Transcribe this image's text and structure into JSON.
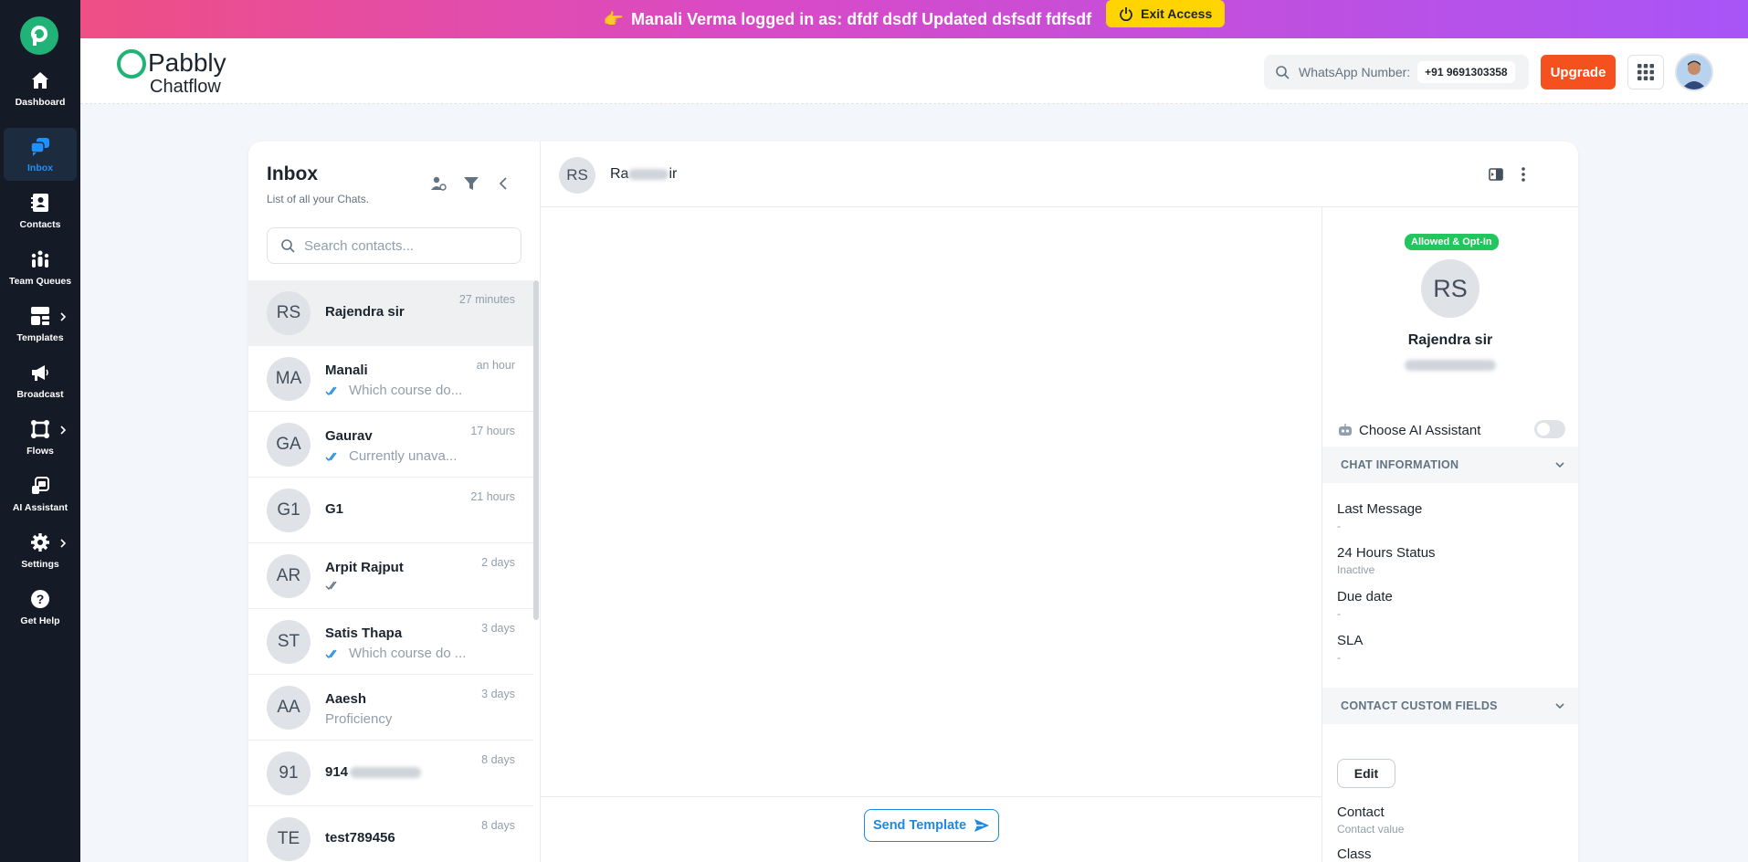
{
  "nav": {
    "items": [
      {
        "label": "Dashboard"
      },
      {
        "label": "Inbox"
      },
      {
        "label": "Contacts"
      },
      {
        "label": "Team Queues"
      },
      {
        "label": "Templates"
      },
      {
        "label": "Broadcast"
      },
      {
        "label": "Flows"
      },
      {
        "label": "AI Assistant"
      },
      {
        "label": "Settings"
      },
      {
        "label": "Get Help"
      }
    ],
    "active": "Inbox"
  },
  "banner": {
    "emoji": "👉",
    "text": "Manali Verma logged in as: dfdf dsdf Updated dsfsdf fdfsdf",
    "exit_label": "Exit Access",
    "exit_color": "#ffd400"
  },
  "header": {
    "brand_line1": "Pabbly",
    "brand_line2": "Chatflow",
    "wa_label": "WhatsApp Number:",
    "wa_number": "+91 9691303358",
    "upgrade_label": "Upgrade",
    "upgrade_color": "#f4511e"
  },
  "inbox": {
    "title": "Inbox",
    "subtitle": "List of all your Chats.",
    "search_placeholder": "Search contacts...",
    "chats": [
      {
        "initials": "RS",
        "name": "Rajendra sir",
        "time": "27 minutes",
        "preview": "",
        "ticks": false
      },
      {
        "initials": "MA",
        "name": "Manali",
        "time": "an hour",
        "preview": "Which course do...",
        "ticks": true
      },
      {
        "initials": "GA",
        "name": "Gaurav",
        "time": "17 hours",
        "preview": "Currently unava...",
        "ticks": true
      },
      {
        "initials": "G1",
        "name": "G1",
        "time": "21 hours",
        "preview": "",
        "ticks": false
      },
      {
        "initials": "AR",
        "name": "Arpit Rajput",
        "time": "2 days",
        "preview": "",
        "ticks": true
      },
      {
        "initials": "ST",
        "name": "Satis Thapa",
        "time": "3 days",
        "preview": "Which course do ...",
        "ticks": true
      },
      {
        "initials": "AA",
        "name": "Aaesh",
        "time": "3 days",
        "preview": "Proficiency",
        "ticks": false
      },
      {
        "initials": "91",
        "name": "914",
        "time": "8 days",
        "preview": "",
        "ticks": false
      },
      {
        "initials": "TE",
        "name": "test789456",
        "time": "8 days",
        "preview": "",
        "ticks": false
      }
    ]
  },
  "conversation": {
    "initials": "RS",
    "name_start": "Ra",
    "name_end": "ir",
    "send_template_label": "Send Template"
  },
  "details": {
    "badge": "Allowed & Opt-In",
    "badge_color": "#22c55e",
    "initials": "RS",
    "name": "Rajendra sir",
    "ai_label": "Choose AI Assistant",
    "chat_info_title": "CHAT INFORMATION",
    "fields": [
      {
        "label": "Last Message",
        "value": "-"
      },
      {
        "label": "24 Hours Status",
        "value": "Inactive"
      },
      {
        "label": "Due date",
        "value": "-"
      },
      {
        "label": "SLA",
        "value": "-"
      }
    ],
    "custom_fields_title": "CONTACT CUSTOM FIELDS",
    "edit_label": "Edit",
    "custom": [
      {
        "label": "Contact",
        "value": "Contact value"
      },
      {
        "label": "Class",
        "value": ""
      }
    ]
  }
}
